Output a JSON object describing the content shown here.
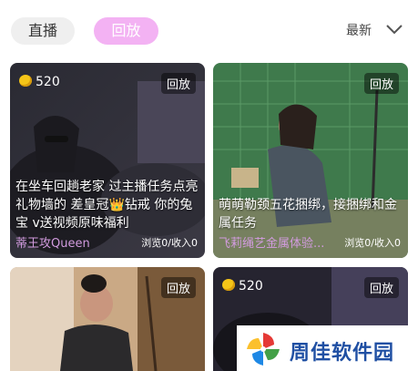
{
  "tabs": [
    {
      "label": "直播"
    },
    {
      "label": "回放"
    }
  ],
  "sort": {
    "label": "最新"
  },
  "cards": [
    {
      "coins": "520",
      "badge": "回放",
      "title": "在坐车回趟老家 过主播任务点亮礼物墙的 差皇冠👑钻戒 你的兔宝    v送视频原味福利",
      "author": "蒂王攻Queen",
      "stats": "浏览0/收入0"
    },
    {
      "badge": "回放",
      "title": "萌萌勒颈五花捆绑，接捆绑和金属任务",
      "author": "飞莉绳艺金属体验...",
      "stats": "浏览0/收入0"
    },
    {
      "badge": "回放"
    },
    {
      "coins": "520",
      "badge": "回放"
    }
  ],
  "watermark": {
    "text": "周佳软件园"
  },
  "colors": {
    "accent_pink": "#f3b2f3",
    "author_purple": "#d29bdf",
    "coin_gold": "#f5c518"
  }
}
